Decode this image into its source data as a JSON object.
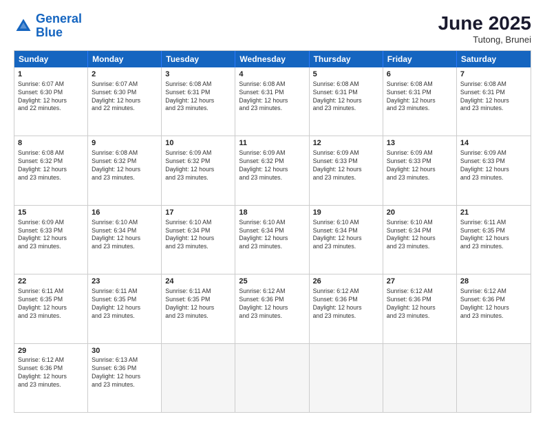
{
  "logo": {
    "line1": "General",
    "line2": "Blue"
  },
  "title": "June 2025",
  "subtitle": "Tutong, Brunei",
  "header_days": [
    "Sunday",
    "Monday",
    "Tuesday",
    "Wednesday",
    "Thursday",
    "Friday",
    "Saturday"
  ],
  "rows": [
    [
      {
        "day": "1",
        "lines": [
          "Sunrise: 6:07 AM",
          "Sunset: 6:30 PM",
          "Daylight: 12 hours",
          "and 22 minutes."
        ]
      },
      {
        "day": "2",
        "lines": [
          "Sunrise: 6:07 AM",
          "Sunset: 6:30 PM",
          "Daylight: 12 hours",
          "and 22 minutes."
        ]
      },
      {
        "day": "3",
        "lines": [
          "Sunrise: 6:08 AM",
          "Sunset: 6:31 PM",
          "Daylight: 12 hours",
          "and 23 minutes."
        ]
      },
      {
        "day": "4",
        "lines": [
          "Sunrise: 6:08 AM",
          "Sunset: 6:31 PM",
          "Daylight: 12 hours",
          "and 23 minutes."
        ]
      },
      {
        "day": "5",
        "lines": [
          "Sunrise: 6:08 AM",
          "Sunset: 6:31 PM",
          "Daylight: 12 hours",
          "and 23 minutes."
        ]
      },
      {
        "day": "6",
        "lines": [
          "Sunrise: 6:08 AM",
          "Sunset: 6:31 PM",
          "Daylight: 12 hours",
          "and 23 minutes."
        ]
      },
      {
        "day": "7",
        "lines": [
          "Sunrise: 6:08 AM",
          "Sunset: 6:31 PM",
          "Daylight: 12 hours",
          "and 23 minutes."
        ]
      }
    ],
    [
      {
        "day": "8",
        "lines": [
          "Sunrise: 6:08 AM",
          "Sunset: 6:32 PM",
          "Daylight: 12 hours",
          "and 23 minutes."
        ]
      },
      {
        "day": "9",
        "lines": [
          "Sunrise: 6:08 AM",
          "Sunset: 6:32 PM",
          "Daylight: 12 hours",
          "and 23 minutes."
        ]
      },
      {
        "day": "10",
        "lines": [
          "Sunrise: 6:09 AM",
          "Sunset: 6:32 PM",
          "Daylight: 12 hours",
          "and 23 minutes."
        ]
      },
      {
        "day": "11",
        "lines": [
          "Sunrise: 6:09 AM",
          "Sunset: 6:32 PM",
          "Daylight: 12 hours",
          "and 23 minutes."
        ]
      },
      {
        "day": "12",
        "lines": [
          "Sunrise: 6:09 AM",
          "Sunset: 6:33 PM",
          "Daylight: 12 hours",
          "and 23 minutes."
        ]
      },
      {
        "day": "13",
        "lines": [
          "Sunrise: 6:09 AM",
          "Sunset: 6:33 PM",
          "Daylight: 12 hours",
          "and 23 minutes."
        ]
      },
      {
        "day": "14",
        "lines": [
          "Sunrise: 6:09 AM",
          "Sunset: 6:33 PM",
          "Daylight: 12 hours",
          "and 23 minutes."
        ]
      }
    ],
    [
      {
        "day": "15",
        "lines": [
          "Sunrise: 6:09 AM",
          "Sunset: 6:33 PM",
          "Daylight: 12 hours",
          "and 23 minutes."
        ]
      },
      {
        "day": "16",
        "lines": [
          "Sunrise: 6:10 AM",
          "Sunset: 6:34 PM",
          "Daylight: 12 hours",
          "and 23 minutes."
        ]
      },
      {
        "day": "17",
        "lines": [
          "Sunrise: 6:10 AM",
          "Sunset: 6:34 PM",
          "Daylight: 12 hours",
          "and 23 minutes."
        ]
      },
      {
        "day": "18",
        "lines": [
          "Sunrise: 6:10 AM",
          "Sunset: 6:34 PM",
          "Daylight: 12 hours",
          "and 23 minutes."
        ]
      },
      {
        "day": "19",
        "lines": [
          "Sunrise: 6:10 AM",
          "Sunset: 6:34 PM",
          "Daylight: 12 hours",
          "and 23 minutes."
        ]
      },
      {
        "day": "20",
        "lines": [
          "Sunrise: 6:10 AM",
          "Sunset: 6:34 PM",
          "Daylight: 12 hours",
          "and 23 minutes."
        ]
      },
      {
        "day": "21",
        "lines": [
          "Sunrise: 6:11 AM",
          "Sunset: 6:35 PM",
          "Daylight: 12 hours",
          "and 23 minutes."
        ]
      }
    ],
    [
      {
        "day": "22",
        "lines": [
          "Sunrise: 6:11 AM",
          "Sunset: 6:35 PM",
          "Daylight: 12 hours",
          "and 23 minutes."
        ]
      },
      {
        "day": "23",
        "lines": [
          "Sunrise: 6:11 AM",
          "Sunset: 6:35 PM",
          "Daylight: 12 hours",
          "and 23 minutes."
        ]
      },
      {
        "day": "24",
        "lines": [
          "Sunrise: 6:11 AM",
          "Sunset: 6:35 PM",
          "Daylight: 12 hours",
          "and 23 minutes."
        ]
      },
      {
        "day": "25",
        "lines": [
          "Sunrise: 6:12 AM",
          "Sunset: 6:36 PM",
          "Daylight: 12 hours",
          "and 23 minutes."
        ]
      },
      {
        "day": "26",
        "lines": [
          "Sunrise: 6:12 AM",
          "Sunset: 6:36 PM",
          "Daylight: 12 hours",
          "and 23 minutes."
        ]
      },
      {
        "day": "27",
        "lines": [
          "Sunrise: 6:12 AM",
          "Sunset: 6:36 PM",
          "Daylight: 12 hours",
          "and 23 minutes."
        ]
      },
      {
        "day": "28",
        "lines": [
          "Sunrise: 6:12 AM",
          "Sunset: 6:36 PM",
          "Daylight: 12 hours",
          "and 23 minutes."
        ]
      }
    ],
    [
      {
        "day": "29",
        "lines": [
          "Sunrise: 6:12 AM",
          "Sunset: 6:36 PM",
          "Daylight: 12 hours",
          "and 23 minutes."
        ]
      },
      {
        "day": "30",
        "lines": [
          "Sunrise: 6:13 AM",
          "Sunset: 6:36 PM",
          "Daylight: 12 hours",
          "and 23 minutes."
        ]
      },
      {
        "day": "",
        "lines": []
      },
      {
        "day": "",
        "lines": []
      },
      {
        "day": "",
        "lines": []
      },
      {
        "day": "",
        "lines": []
      },
      {
        "day": "",
        "lines": []
      }
    ]
  ]
}
